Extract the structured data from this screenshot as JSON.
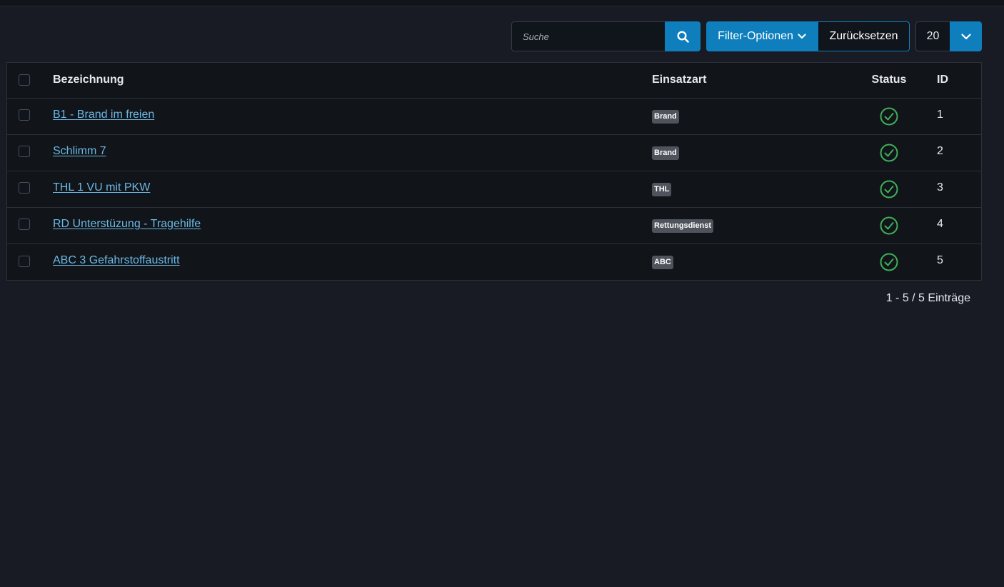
{
  "search": {
    "placeholder": "Suche"
  },
  "toolbar": {
    "filter_label": "Filter-Optionen",
    "reset_label": "Zurücksetzen",
    "limit_value": "20"
  },
  "table": {
    "columns": {
      "name": "Bezeichnung",
      "type": "Einsatzart",
      "status": "Status",
      "id": "ID"
    },
    "rows": [
      {
        "name": "B1 - Brand im freien",
        "type": "Brand",
        "status": "published",
        "id": "1"
      },
      {
        "name": "Schlimm 7",
        "type": "Brand",
        "status": "published",
        "id": "2"
      },
      {
        "name": "THL 1 VU mit PKW",
        "type": "THL",
        "status": "published",
        "id": "3"
      },
      {
        "name": "RD Unterstüzung - Tragehilfe",
        "type": "Rettungsdienst",
        "status": "published",
        "id": "4"
      },
      {
        "name": "ABC 3 Gefahrstoffaustritt",
        "type": "ABC",
        "status": "published",
        "id": "5"
      }
    ]
  },
  "pagination": {
    "summary": "1 - 5 / 5 Einträge"
  },
  "colors": {
    "accent": "#0e7fbc",
    "link": "#6bb8e4",
    "status_ok": "#3fae5a",
    "background": "#181b23"
  }
}
